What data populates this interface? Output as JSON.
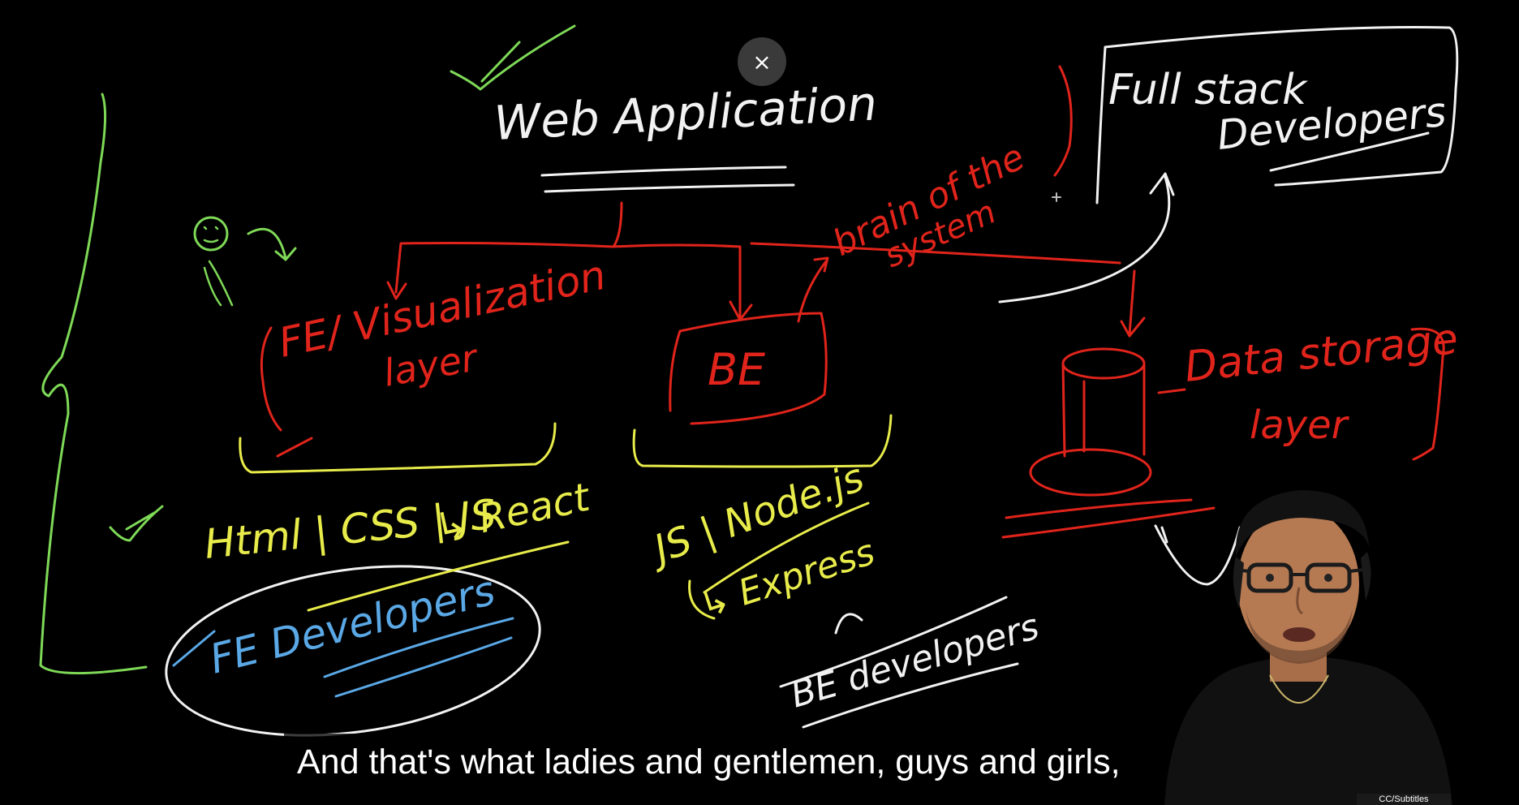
{
  "overlay": {
    "close_glyph": "×"
  },
  "whiteboard": {
    "title": "Web Application",
    "frontend_box": "FE/ Visualization layer",
    "frontend_box_line1": "FE/ Visualization",
    "frontend_box_line2": "layer",
    "backend_box": "BE",
    "brain_label": "brain of the system",
    "brain_line1": "brain of the",
    "brain_line2": "system",
    "fullstack_line1": "Full stack",
    "fullstack_line2": "Developers",
    "data_storage_line1": "Data storage",
    "data_storage_line2": "layer",
    "fe_tech_line1": "Html | CSS | JS",
    "fe_tech_line2": "↳ React",
    "be_tech_line1": "JS | Node.js",
    "be_tech_line2": "↳ Express",
    "fe_developers": "FE Developers",
    "be_developers": "BE developers"
  },
  "caption": {
    "text": "And that's what ladies and gentlemen, guys and girls,"
  },
  "cc_badge": {
    "label": "CC/Subtitles"
  },
  "colors": {
    "background": "#000000",
    "white_ink": "#f2f2f2",
    "red_ink": "#e0241b",
    "yellow_ink": "#e8ec4a",
    "green_ink": "#7ed957",
    "blue_ink": "#5aa8e6"
  },
  "presenter": {
    "icon": "presenter-avatar"
  }
}
